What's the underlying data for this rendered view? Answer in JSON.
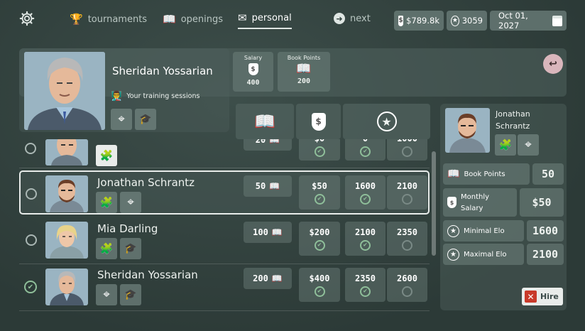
{
  "nav": {
    "tournaments": "tournaments",
    "openings": "openings",
    "personal": "personal",
    "next": "next"
  },
  "top": {
    "money": "$789.8k",
    "elo": "3059",
    "date": "Oct 01, 2027"
  },
  "player": {
    "name": "Sheridan Yossarian",
    "sessions_label": "Your training sessions",
    "salary_label": "Salary",
    "salary_value": "400",
    "book_label": "Book Points",
    "book_value": "200"
  },
  "rows": [
    {
      "name": "Jonathan Schrantz",
      "books": "50",
      "salary": "$50",
      "min": "1600",
      "max": "2100",
      "selected": true
    },
    {
      "name": "Mia Darling",
      "books": "100",
      "salary": "$200",
      "min": "2100",
      "max": "2350"
    },
    {
      "name": "Sheridan Yossarian",
      "books": "200",
      "salary": "$400",
      "min": "2350",
      "max": "2600"
    }
  ],
  "partial": {
    "books": "20",
    "salary": "$0",
    "min": "0",
    "max": "1000"
  },
  "detail": {
    "first": "Jonathan",
    "last": "Schrantz",
    "book_label": "Book Points",
    "book_value": "50",
    "salary_label1": "Monthly",
    "salary_label2": "Salary",
    "salary_value": "$50",
    "min_label": "Minimal Elo",
    "min_value": "1600",
    "max_label": "Maximal Elo",
    "max_value": "2100",
    "hire": "Hire"
  },
  "colors": {
    "accent_red": "#c83a2a",
    "check_green": "#8fbf9a"
  }
}
